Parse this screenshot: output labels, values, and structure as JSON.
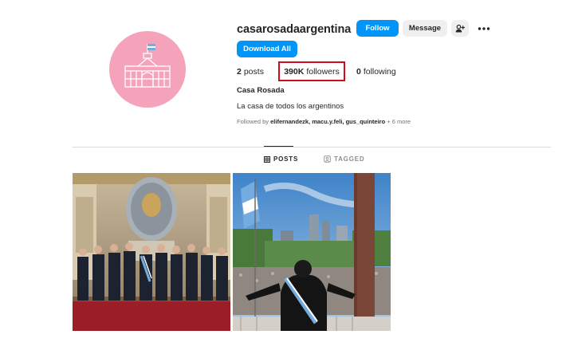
{
  "profile": {
    "username": "casarosadaargentina",
    "full_name": "Casa Rosada",
    "bio": "La casa de todos los argentinos",
    "followed_by_prefix": "Followed by ",
    "followed_by_names": "elifernandezk, macu.y.feli, gus_quinteiro",
    "followed_by_more": " + 6 more",
    "avatar_color": "#f4a3bb"
  },
  "buttons": {
    "follow": "Follow",
    "message": "Message",
    "download_all": "Download All",
    "add_user_icon": "add-user-icon",
    "more_icon": "more-options-icon",
    "accent": "#0095f6"
  },
  "stats": {
    "posts_count": "2",
    "posts_label": "posts",
    "followers_count": "390K",
    "followers_label": "followers",
    "following_count": "0",
    "following_label": "following",
    "highlight_color": "#d10a1f"
  },
  "tabs": [
    {
      "label": "POSTS",
      "icon": "grid-icon",
      "active": true
    },
    {
      "label": "TAGGED",
      "icon": "tagged-icon",
      "active": false
    }
  ],
  "posts": [
    {
      "type": "image",
      "subject": "group-photo"
    },
    {
      "type": "image",
      "subject": "balcony-crowd"
    }
  ]
}
